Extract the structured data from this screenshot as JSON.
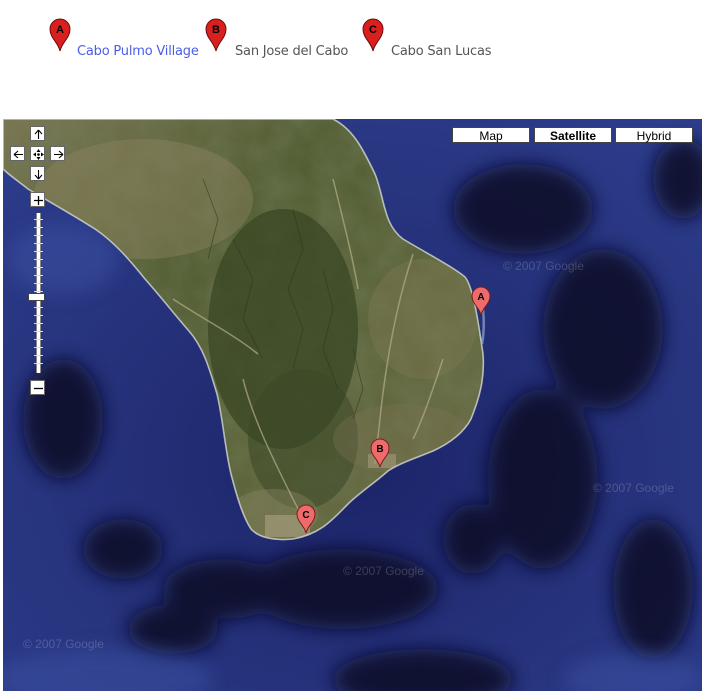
{
  "legend": [
    {
      "letter": "A",
      "label": "Cabo Pulmo Village",
      "link": true
    },
    {
      "letter": "B",
      "label": "San Jose del Cabo",
      "link": false
    },
    {
      "letter": "C",
      "label": "Cabo San Lucas",
      "link": false
    }
  ],
  "map_types": {
    "map": "Map",
    "satellite": "Satellite",
    "hybrid": "Hybrid",
    "selected": "Satellite"
  },
  "markers": [
    {
      "letter": "A",
      "name": "Cabo Pulmo Village"
    },
    {
      "letter": "B",
      "name": "San Jose del Cabo"
    },
    {
      "letter": "C",
      "name": "Cabo San Lucas"
    }
  ],
  "watermarks": [
    "© 2007 Google",
    "© 2007 Google",
    "© 2007 Google",
    "© 2007 Google"
  ],
  "colors": {
    "marker_fill": "#ee6b6b",
    "legend_marker_fill": "#d9201f",
    "link": "#4a5ee8",
    "ocean": "#1f2a6e",
    "land": "#5f6b3a"
  }
}
